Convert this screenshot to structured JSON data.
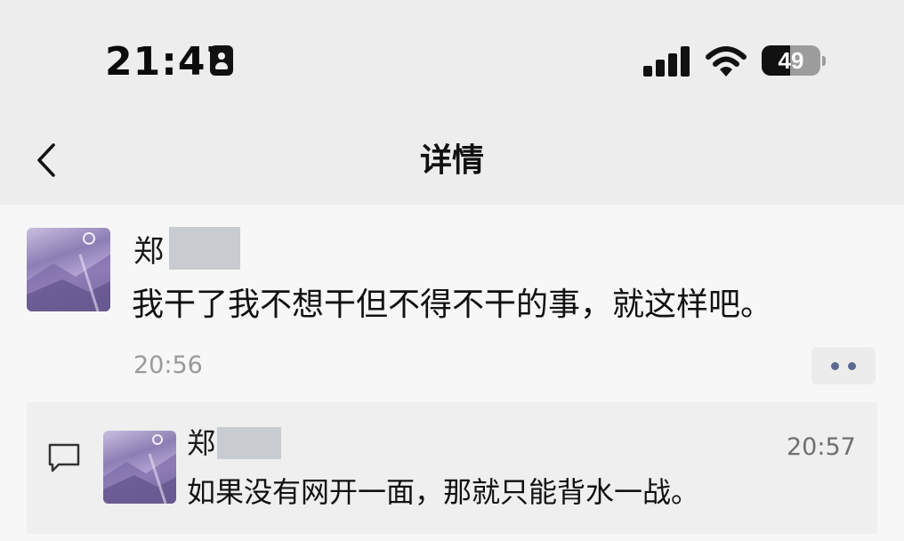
{
  "status_bar": {
    "time": "21:47",
    "battery_percent": "49",
    "battery_level": 0.49,
    "icons": [
      "id-badge-icon",
      "signal-icon",
      "wifi-icon",
      "battery-icon"
    ]
  },
  "nav": {
    "back_icon": "chevron-left-icon",
    "title": "详情"
  },
  "post": {
    "author": "郑",
    "text": "我干了我不想干但不得不干的事，就这样吧。",
    "time": "20:56",
    "more_icon": "more-dots-icon"
  },
  "comment": {
    "icon": "comment-icon",
    "author": "郑",
    "text": "如果没有网开一面，那就只能背水一战。",
    "time": "20:57"
  },
  "colors": {
    "background": "#ededed",
    "content_bg": "#f7f7f7",
    "comment_bg": "#efefef",
    "accent_dots": "#5b6a91",
    "muted_text": "#9a9a9a"
  }
}
